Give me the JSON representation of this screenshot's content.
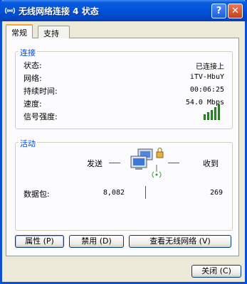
{
  "window": {
    "title": "无线网络连接 4 状态",
    "help_label": "?",
    "close_label": "✕"
  },
  "tabs": [
    {
      "label": "常规"
    },
    {
      "label": "支持"
    }
  ],
  "connection": {
    "title": "连接",
    "rows": [
      {
        "label": "状态:",
        "value": "已连接上"
      },
      {
        "label": "网络:",
        "value": "iTV-HbuY"
      },
      {
        "label": "持续时间:",
        "value": "00:06:25"
      },
      {
        "label": "速度:",
        "value": "54.0 Mbps"
      },
      {
        "label": "信号强度:",
        "value": ""
      }
    ],
    "signal_bars": 5
  },
  "activity": {
    "title": "活动",
    "sent_label": "发送",
    "received_label": "收到",
    "packets_label": "数据包:",
    "packets_sent": "8,082",
    "packets_received": "269"
  },
  "buttons": {
    "properties": "属性 (P)",
    "disable": "禁用 (D)",
    "view_wireless": "查看无线网络 (V)",
    "close": "关闭 (C)"
  },
  "colors": {
    "titlebar": "#0254d8",
    "group_title": "#0046d5",
    "signal": "#2ea12a"
  }
}
